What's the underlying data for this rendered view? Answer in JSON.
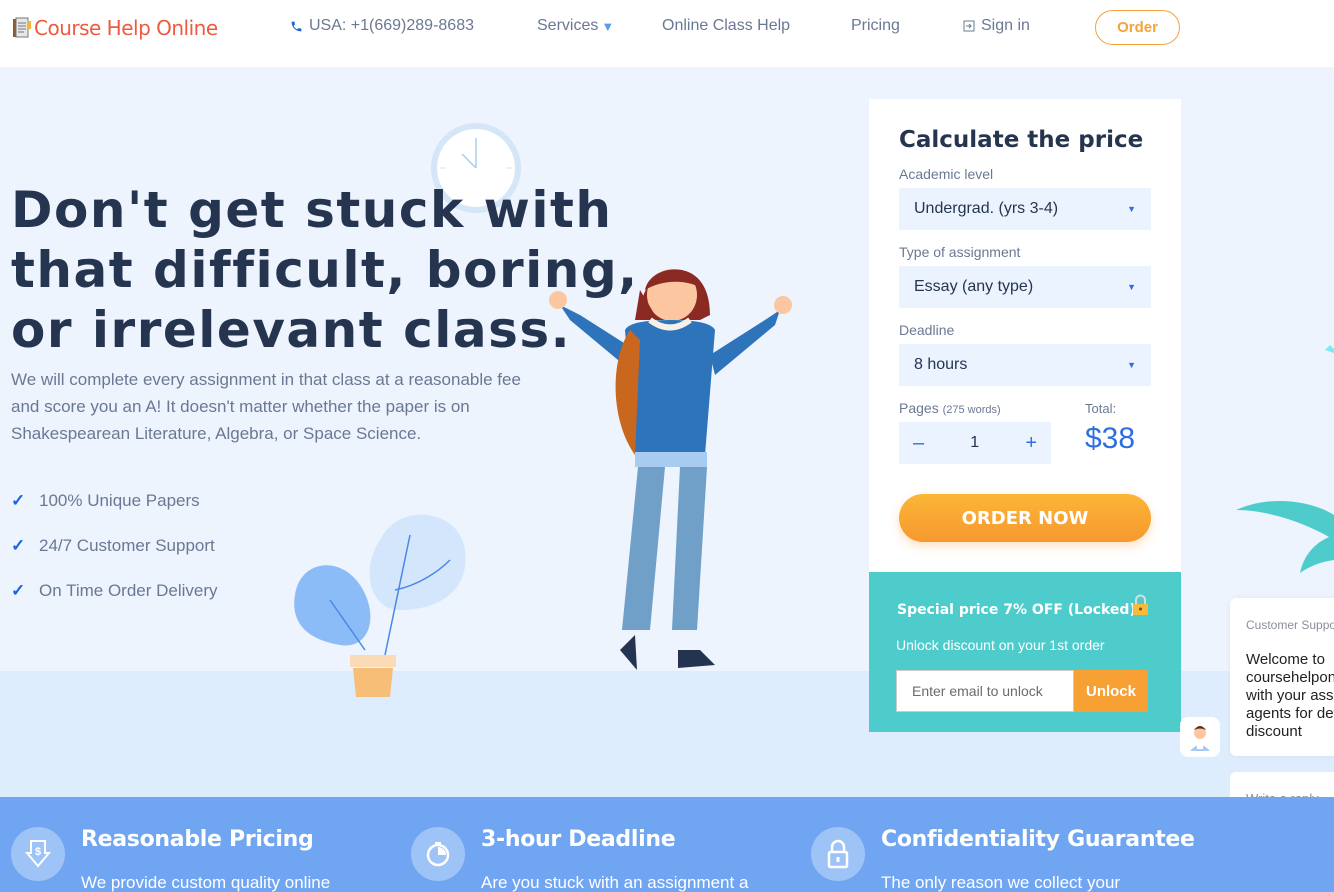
{
  "header": {
    "logo_text": "Course Help Online",
    "phone": "USA: +1(669)289-8683",
    "nav": {
      "services": "Services",
      "online_class_help": "Online Class Help",
      "pricing": "Pricing",
      "sign_in": "Sign in"
    },
    "order_label": "Order"
  },
  "hero": {
    "title_lines": [
      "Don't get stuck with",
      "that difficult, boring,",
      "or irrelevant class."
    ],
    "description": "We will complete every assignment in that class at a reasonable fee and score you an A! It doesn't matter whether the paper is on Shakespearean Literature, Algebra, or Space Science.",
    "features": [
      "100% Unique Papers",
      "24/7 Customer Support",
      "On Time Order Delivery"
    ]
  },
  "calculator": {
    "title": "Calculate the price",
    "academic_level_label": "Academic level",
    "academic_level_value": "Undergrad. (yrs 3-4)",
    "assignment_type_label": "Type of assignment",
    "assignment_type_value": "Essay (any type)",
    "deadline_label": "Deadline",
    "deadline_value": "8 hours",
    "pages_label": "Pages",
    "pages_words": "(275 words)",
    "pages_value": "1",
    "minus": "–",
    "plus": "+",
    "total_label": "Total:",
    "total_value": "$38",
    "order_now": "ORDER NOW"
  },
  "promo": {
    "title": "Special price 7% OFF (Locked)",
    "subtitle": "Unlock discount on your 1st order",
    "email_placeholder": "Enter email to unlock",
    "unlock_label": "Unlock"
  },
  "chat": {
    "header": "Customer Support",
    "message": "Welcome to\ncoursehelponline\nwith your assignment\nagents for details\ndiscount",
    "reply_placeholder": "Write a reply.."
  },
  "band": [
    {
      "icon": "dollar-down-icon",
      "title": "Reasonable Pricing",
      "text": "We provide custom quality online"
    },
    {
      "icon": "stopwatch-icon",
      "title": "3-hour Deadline",
      "text": "Are you stuck with an assignment a"
    },
    {
      "icon": "lock-icon",
      "title": "Confidentiality Guarantee",
      "text": "The only reason we collect your"
    }
  ],
  "colors": {
    "brand_red": "#ee5a3f",
    "accent_orange": "#f7a033",
    "accent_blue": "#2b6fe0",
    "teal": "#4ecccc",
    "band_blue": "#70a5f2"
  }
}
